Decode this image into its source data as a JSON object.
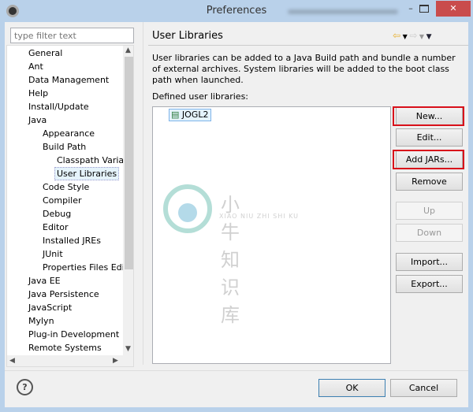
{
  "window": {
    "title": "Preferences",
    "minimize": "–",
    "close": "✕"
  },
  "filter": {
    "placeholder": "type filter text"
  },
  "tree": [
    {
      "label": "General",
      "level": 0
    },
    {
      "label": "Ant",
      "level": 0
    },
    {
      "label": "Data Management",
      "level": 0
    },
    {
      "label": "Help",
      "level": 0
    },
    {
      "label": "Install/Update",
      "level": 0
    },
    {
      "label": "Java",
      "level": 0
    },
    {
      "label": "Appearance",
      "level": 1
    },
    {
      "label": "Build Path",
      "level": 1
    },
    {
      "label": "Classpath Variab",
      "level": 2
    },
    {
      "label": "User Libraries",
      "level": 2,
      "selected": true
    },
    {
      "label": "Code Style",
      "level": 1
    },
    {
      "label": "Compiler",
      "level": 1
    },
    {
      "label": "Debug",
      "level": 1
    },
    {
      "label": "Editor",
      "level": 1
    },
    {
      "label": "Installed JREs",
      "level": 1
    },
    {
      "label": "JUnit",
      "level": 1
    },
    {
      "label": "Properties Files Edito",
      "level": 1
    },
    {
      "label": "Java EE",
      "level": 0
    },
    {
      "label": "Java Persistence",
      "level": 0
    },
    {
      "label": "JavaScript",
      "level": 0
    },
    {
      "label": "Mylyn",
      "level": 0
    },
    {
      "label": "Plug-in Development",
      "level": 0
    },
    {
      "label": "Remote Systems",
      "level": 0
    }
  ],
  "page": {
    "title": "User Libraries",
    "description": "User libraries can be added to a Java Build path and bundle a number of external archives. System libraries will be added to the boot class path when launched.",
    "defined_label": "Defined user libraries:",
    "libraries": [
      "JOGL2"
    ]
  },
  "buttons": {
    "new": "New...",
    "edit": "Edit...",
    "add_jars": "Add JARs...",
    "remove": "Remove",
    "up": "Up",
    "down": "Down",
    "import": "Import...",
    "export": "Export...",
    "ok": "OK",
    "cancel": "Cancel",
    "help": "?"
  },
  "highlight_color": "#d8101a",
  "watermark": {
    "cn": "小牛知识库",
    "en": "XIAO NIU ZHI SHI KU"
  }
}
